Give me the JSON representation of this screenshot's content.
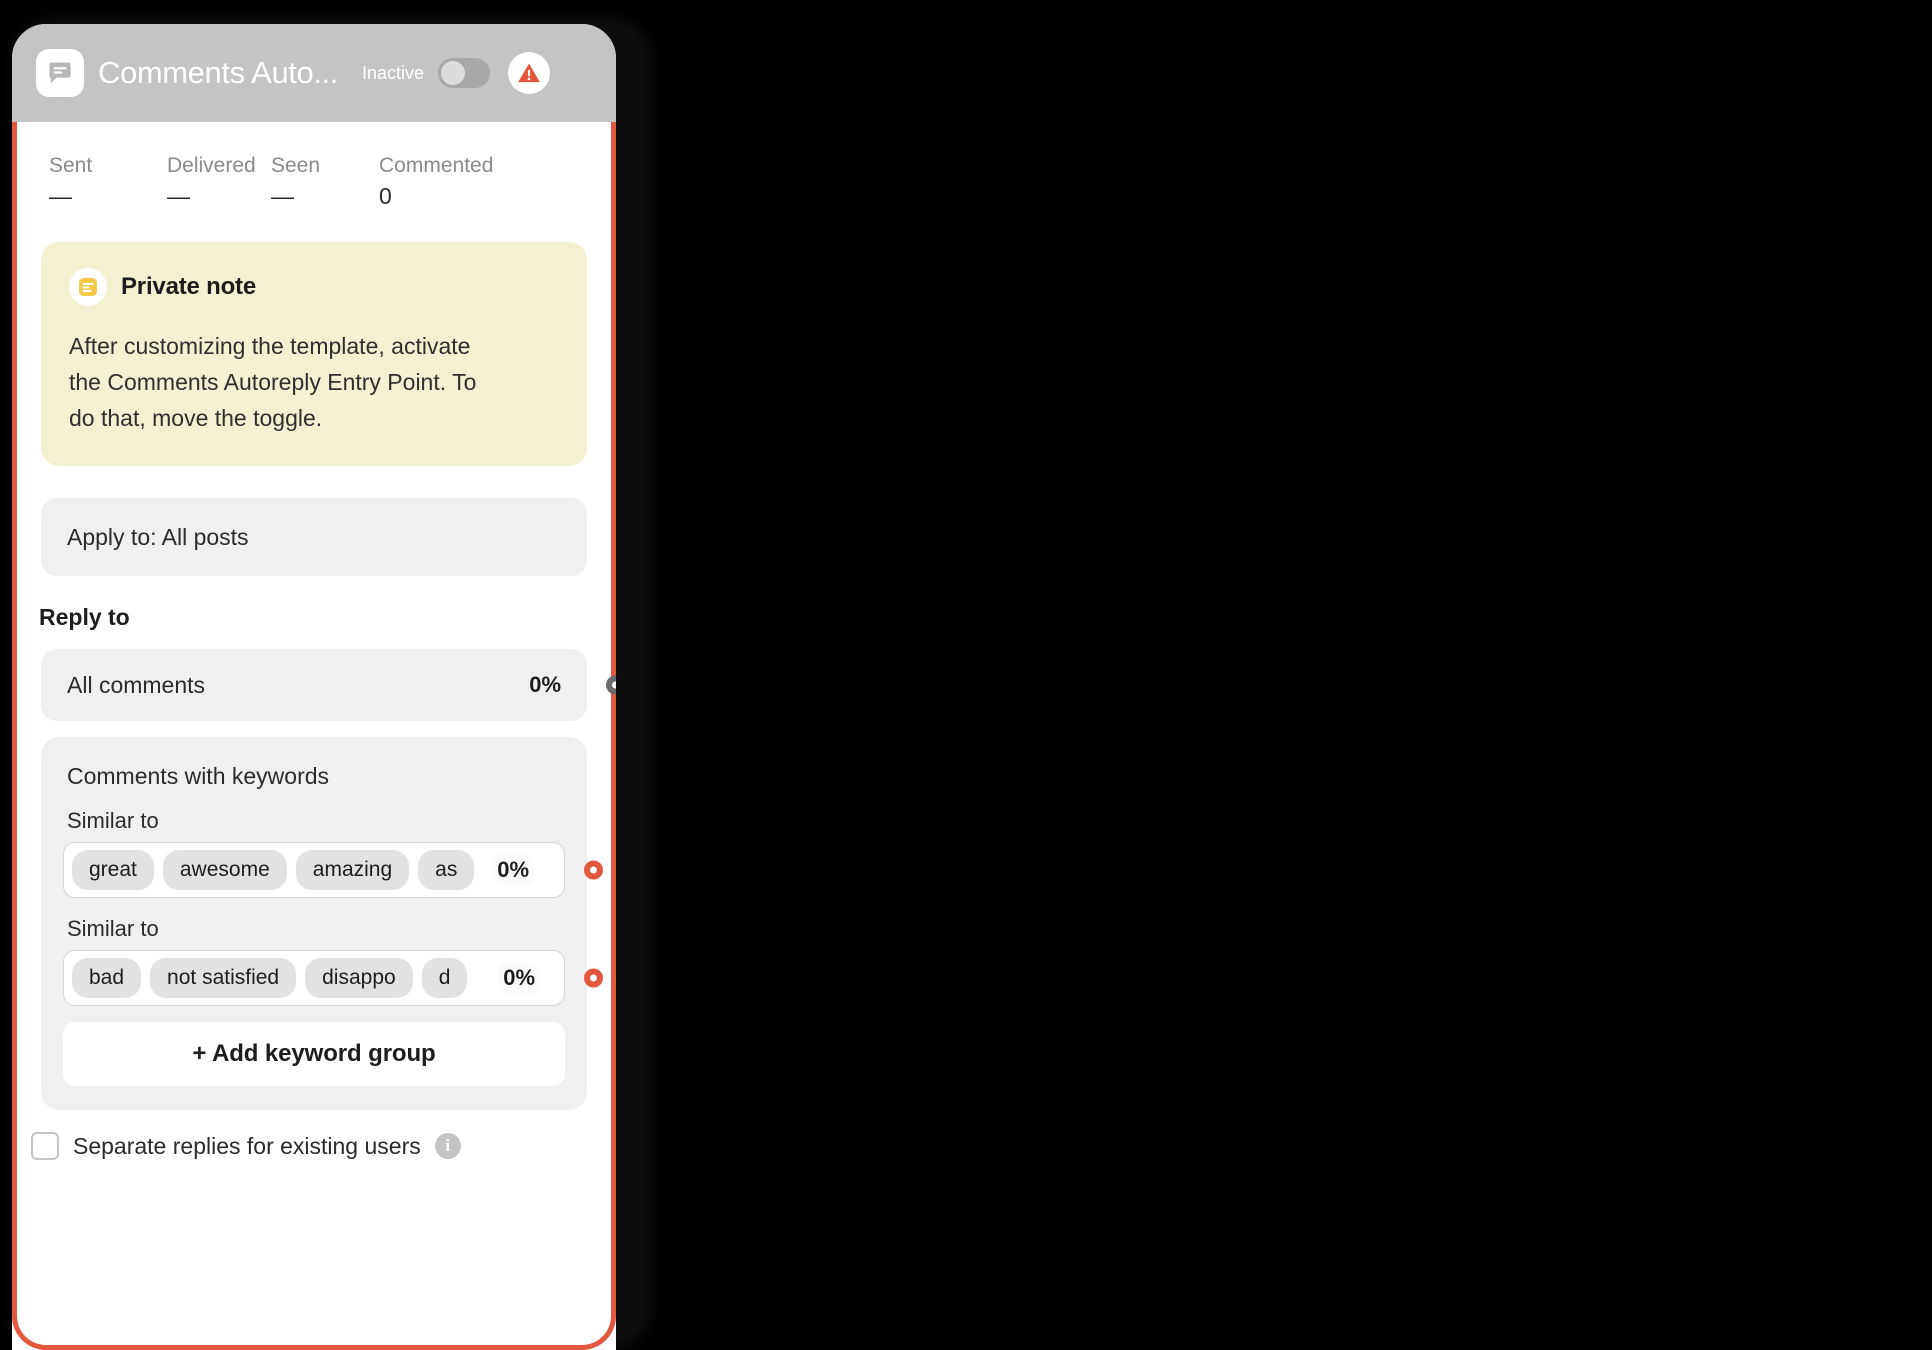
{
  "header": {
    "app_icon": "comment-bubble-icon",
    "title": "Comments Auto...",
    "status_label": "Inactive",
    "toggle_state": "off",
    "warning_icon": "warning-triangle-icon",
    "bar_color": "#c4c4c4"
  },
  "stats": [
    {
      "label": "Sent",
      "value": "—"
    },
    {
      "label": "Delivered",
      "value": "—"
    },
    {
      "label": "Seen",
      "value": "—"
    },
    {
      "label": "Commented",
      "value": "0"
    }
  ],
  "private_note": {
    "icon": "note-lines-icon",
    "title": "Private note",
    "body": "After customizing the template, activate the Comments Autoreply Entry Point. To do that, move the toggle.",
    "background": "#f4f1d0"
  },
  "apply_to": {
    "label": "Apply to: All posts"
  },
  "reply_to": {
    "heading": "Reply to",
    "all_comments": {
      "label": "All comments",
      "percent": "0%",
      "port_color": "#6c6c6c"
    },
    "keyword_panel": {
      "title": "Comments with keywords",
      "groups": [
        {
          "label": "Similar to",
          "tags": [
            "great",
            "awesome",
            "amazing",
            "as"
          ],
          "percent": "0%",
          "port_color": "#e2583f"
        },
        {
          "label": "Similar to",
          "tags": [
            "bad",
            "not satisfied",
            "disappo",
            "d"
          ],
          "percent": "0%",
          "port_color": "#e2583f"
        }
      ],
      "add_group_label": "+  Add keyword group"
    }
  },
  "separate_replies": {
    "checked": false,
    "label": "Separate replies for existing users",
    "info_icon": "info-icon",
    "info_glyph": "i"
  },
  "colors": {
    "accent": "#e2583f",
    "header_gray": "#c4c4c4",
    "note_yellow": "#f4f1d0",
    "field_gray": "#f0f0f0"
  }
}
